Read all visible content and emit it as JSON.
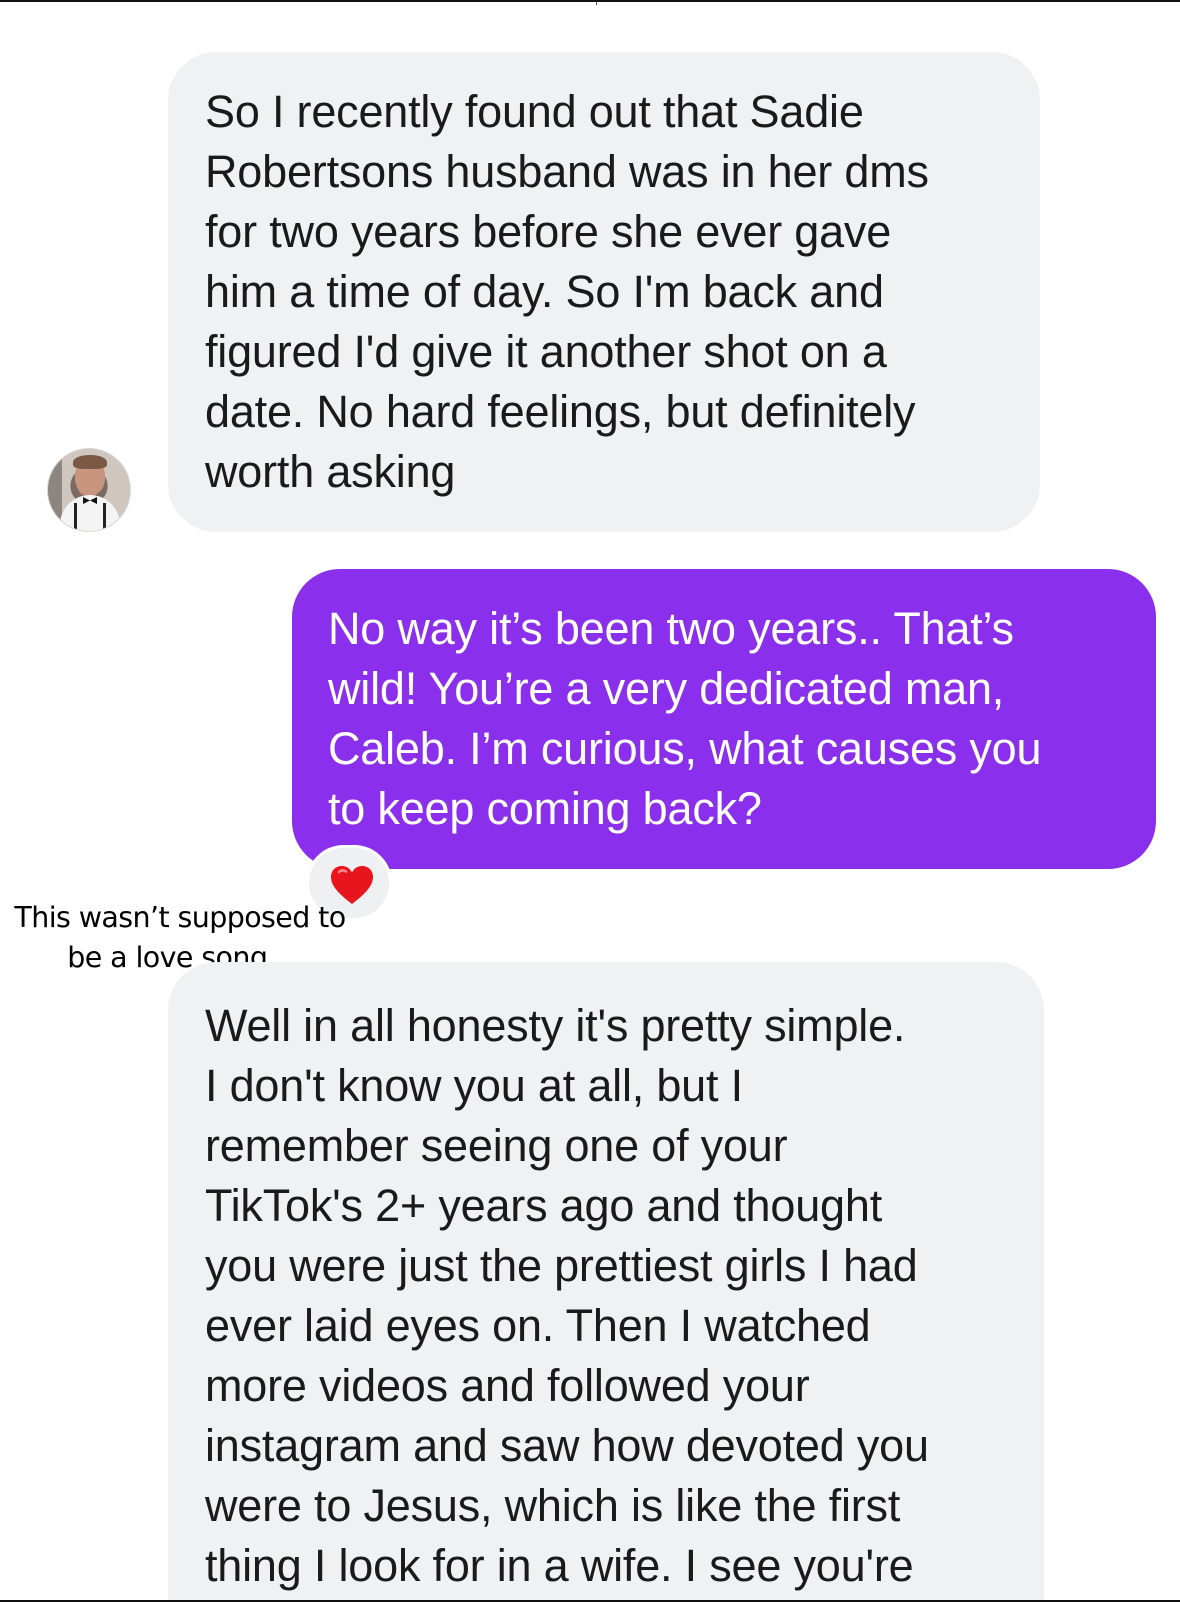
{
  "conversation": {
    "messages": [
      {
        "direction": "incoming",
        "lines": [
          "So I recently found out that Sadie",
          "Robertsons husband was in her dms",
          "for two years before she ever gave",
          "him a time of day. So I'm back and",
          "figured I'd give it another shot on a",
          "date. No hard feelings, but definitely",
          "worth asking"
        ]
      },
      {
        "direction": "outgoing",
        "lines": [
          "No way it’s been two years.. That’s",
          "wild! You’re a very dedicated man,",
          "Caleb. I’m curious, what causes you",
          "to keep coming back?"
        ],
        "reaction": "❤️"
      },
      {
        "direction": "incoming",
        "lines": [
          "Well in all honesty it's pretty simple.",
          "I don't know you at all, but I",
          "remember seeing one of your",
          "TikTok's 2+ years ago and thought",
          "you were just the prettiest girls I had",
          "ever laid eyes on. Then I watched",
          "more videos and followed your",
          "instagram and saw how devoted you",
          "were to Jesus, which is like the first",
          "thing I look for in a wife. I see you're"
        ]
      }
    ]
  },
  "caption": {
    "lines": [
      "This wasn’t supposed to",
      "be a love song..."
    ]
  },
  "icons": {
    "avatar": "contact-avatar-photo",
    "reaction": "red-heart-icon"
  },
  "colors": {
    "incoming_bubble": "#f0f1f3",
    "outgoing_bubble": "#8a30ec",
    "reaction_heart": "#e8141e"
  }
}
